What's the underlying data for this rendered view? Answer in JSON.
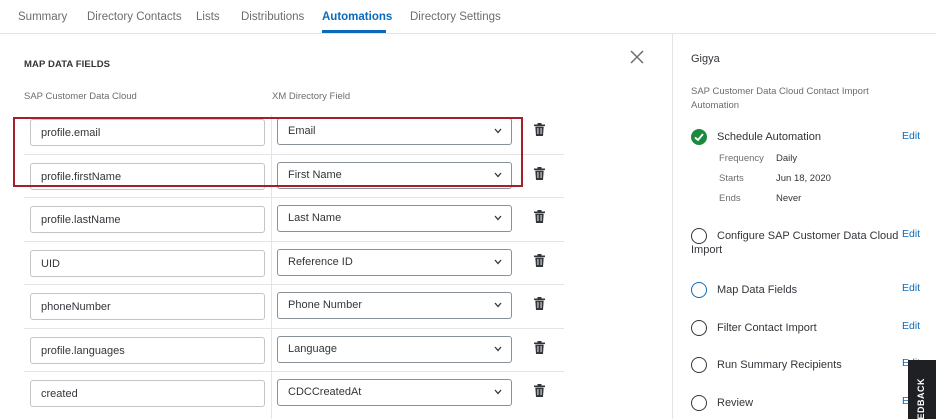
{
  "tabs": [
    {
      "label": "Summary",
      "active": false
    },
    {
      "label": "Directory Contacts",
      "active": false
    },
    {
      "label": "Lists",
      "active": false
    },
    {
      "label": "Distributions",
      "active": false
    },
    {
      "label": "Automations",
      "active": true
    },
    {
      "label": "Directory Settings",
      "active": false
    }
  ],
  "main": {
    "section_title": "MAP DATA FIELDS",
    "col_source": "SAP Customer Data Cloud",
    "col_dest": "XM Directory Field",
    "rows": [
      {
        "source": "profile.email",
        "dest": "Email"
      },
      {
        "source": "profile.firstName",
        "dest": "First Name"
      },
      {
        "source": "profile.lastName",
        "dest": "Last Name"
      },
      {
        "source": "UID",
        "dest": "Reference ID"
      },
      {
        "source": "phoneNumber",
        "dest": "Phone Number"
      },
      {
        "source": "profile.languages",
        "dest": "Language"
      },
      {
        "source": "created",
        "dest": "CDCCreatedAt"
      }
    ]
  },
  "side": {
    "title": "Gigya",
    "desc": "SAP Customer Data Cloud Contact Import Automation",
    "edit_label": "Edit",
    "steps": [
      {
        "label": "Schedule Automation",
        "state": "done"
      },
      {
        "label": "Configure SAP Customer Data Cloud",
        "label2": "Import",
        "state": "empty"
      },
      {
        "label": "Map Data Fields",
        "state": "current"
      },
      {
        "label": "Filter Contact Import",
        "state": "empty"
      },
      {
        "label": "Run Summary Recipients",
        "state": "empty"
      },
      {
        "label": "Review",
        "state": "empty"
      }
    ],
    "schedule": {
      "frequency_label": "Frequency",
      "frequency": "Daily",
      "starts_label": "Starts",
      "starts": "Jun 18, 2020",
      "ends_label": "Ends",
      "ends": "Never"
    }
  },
  "feedback_label": "FEEDBACK",
  "colors": {
    "accent": "#0b6ab9",
    "success": "#1a8a3f",
    "highlight": "#a31f2b"
  }
}
